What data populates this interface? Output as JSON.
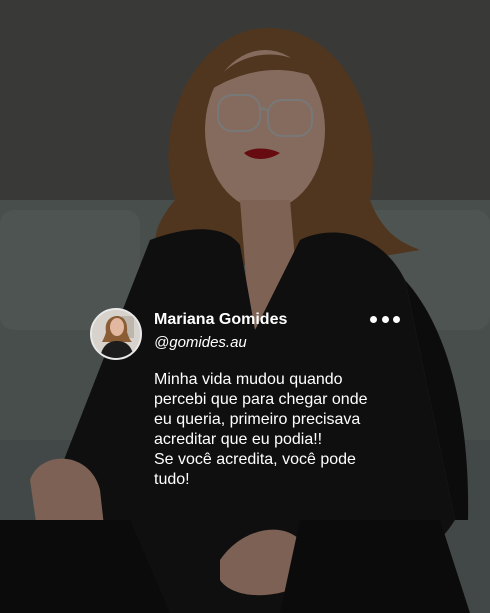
{
  "post": {
    "author_name": "Mariana Gomides",
    "handle": "@gomides.au",
    "text": "Minha vida mudou quando\npercebi que para chegar onde\neu queria, primeiro precisava\nacreditar que eu podia!!\nSe você acredita, você pode\ntudo!",
    "more_icon": "more-horizontal-icon"
  },
  "colors": {
    "text": "#ffffff",
    "overlay": "#000000",
    "backdrop_wall": "#5b5b58",
    "sofa": "#7f8b88",
    "blouse": "#151515"
  }
}
